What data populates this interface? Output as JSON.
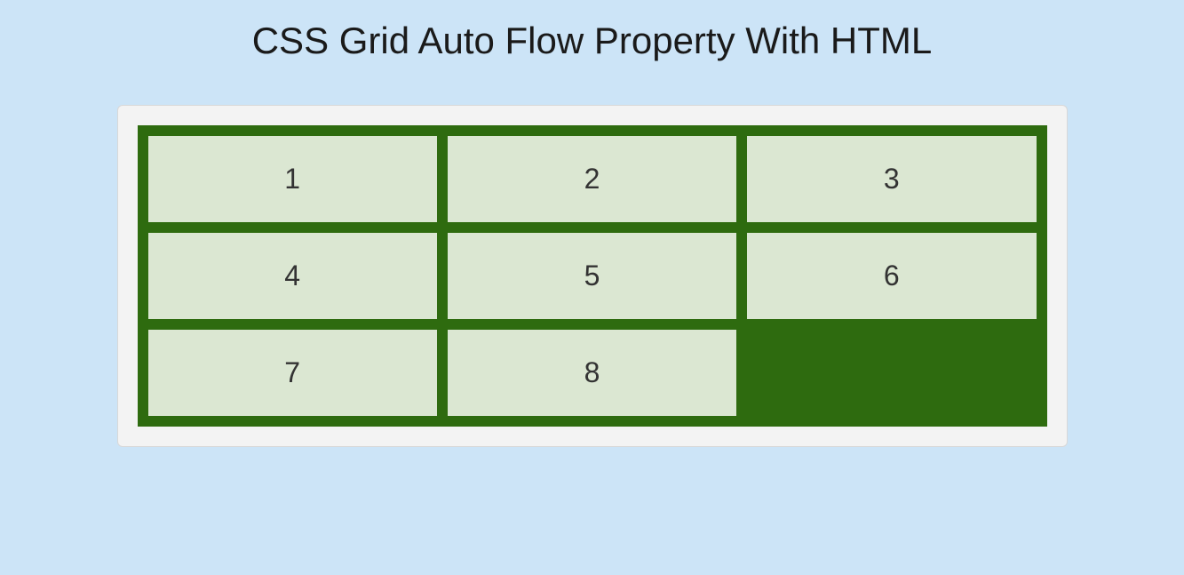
{
  "title": "CSS Grid Auto Flow Property With HTML",
  "grid": {
    "items": [
      "1",
      "2",
      "3",
      "4",
      "5",
      "6",
      "7",
      "8"
    ]
  }
}
